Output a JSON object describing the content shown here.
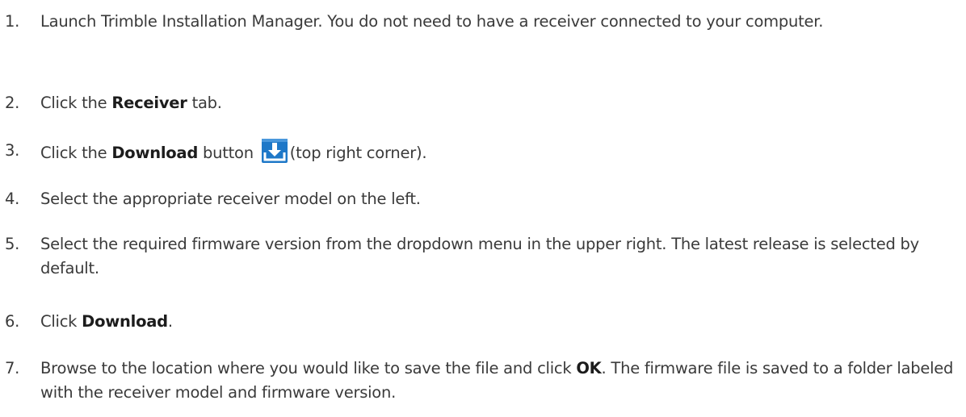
{
  "steps": [
    {
      "number": "1.",
      "parts": [
        "Launch Trimble Installation Manager. You do not need to have a receiver connected to your computer."
      ]
    },
    {
      "number": "2.",
      "parts": [
        "Click the ",
        "Receiver",
        " tab."
      ]
    },
    {
      "number": "3.",
      "parts": [
        "Click the ",
        "Download",
        " button ",
        "(top right corner)."
      ],
      "icon": "download-icon"
    },
    {
      "number": "4.",
      "parts": [
        "Select the appropriate receiver model on the left."
      ]
    },
    {
      "number": "5.",
      "parts": [
        "Select the required firmware version from the dropdown menu in the upper right. The latest release is selected by default."
      ]
    },
    {
      "number": "6.",
      "parts": [
        "Click ",
        "Download",
        "."
      ]
    },
    {
      "number": "7.",
      "parts": [
        "Browse to the location where you would like to save the file and click ",
        "OK",
        ". The firmware file is saved to a folder labeled with the receiver model and firmware version."
      ]
    }
  ],
  "colors": {
    "text": "#3a3a3a",
    "icon_blue": "#1e78c8",
    "icon_white": "#ffffff"
  }
}
